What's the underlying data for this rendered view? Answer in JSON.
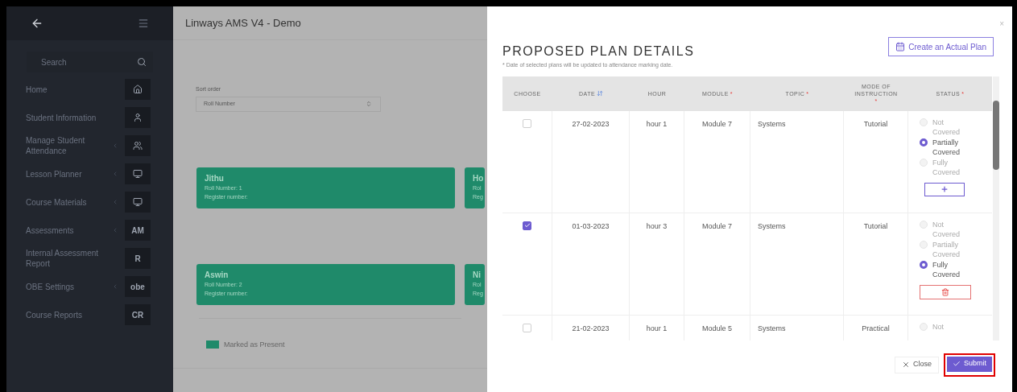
{
  "sidebar": {
    "search": {
      "placeholder": "Search"
    },
    "items": [
      {
        "label": "Home",
        "has_submenu": false
      },
      {
        "label": "Student Information",
        "has_submenu": false
      },
      {
        "label": "Manage Student Attendance",
        "has_submenu": true
      },
      {
        "label": "Lesson Planner",
        "has_submenu": true
      },
      {
        "label": "Course Materials",
        "has_submenu": true
      },
      {
        "label": "Assessments",
        "badge": "AM",
        "has_submenu": true
      },
      {
        "label": "Internal Assessment Report",
        "badge": "R",
        "has_submenu": false
      },
      {
        "label": "OBE Settings",
        "badge": "obe",
        "has_submenu": true
      },
      {
        "label": "Course Reports",
        "badge": "CR",
        "has_submenu": false
      }
    ]
  },
  "main": {
    "title": "Linways AMS V4 - Demo",
    "sort": {
      "label": "Sort order",
      "value": "Roll Number"
    },
    "card_rows": [
      [
        {
          "name": "Jithu",
          "lines": [
            "Roll Number: 1",
            "Register number:"
          ]
        },
        {
          "name": "Ho",
          "lines": [
            "Rol",
            "Reg"
          ]
        }
      ],
      [
        {
          "name": "Aswin",
          "lines": [
            "Roll Number: 2",
            "Register number:"
          ]
        },
        {
          "name": "Ni",
          "lines": [
            "Rol",
            "Reg"
          ]
        }
      ]
    ],
    "legend": {
      "label": "Marked as Present",
      "color": "#1f8a6a"
    }
  },
  "modal": {
    "close": "×",
    "title": "PROPOSED PLAN DETAILS",
    "note": "* Date of selected plans will be updated to attendance marking date.",
    "create_button": "Create an Actual Plan",
    "table": {
      "columns": [
        {
          "label": "CHOOSE",
          "sortable": false
        },
        {
          "label": "DATE",
          "sortable": true
        },
        {
          "label": "HOUR",
          "sortable": false
        },
        {
          "label": "MODULE",
          "required_mark": "*",
          "sortable": false
        },
        {
          "label": "TOPIC",
          "required_mark": "*",
          "sortable": false
        },
        {
          "label": "MODE OF INSTRUCTION",
          "required_mark": "*",
          "sortable": false
        },
        {
          "label": "STATUS",
          "required_mark": "*",
          "sortable": false
        }
      ],
      "rows": [
        {
          "checked": false,
          "date": "27-02-2023",
          "hour": "hour 1",
          "module": "Module 7",
          "topic": "Systems",
          "mode": "Tutorial",
          "status": [
            {
              "label": "Not Covered",
              "selected": false
            },
            {
              "label": "Partially Covered",
              "selected": true
            },
            {
              "label": "Fully Covered",
              "selected": false
            }
          ],
          "kind": "add"
        },
        {
          "checked": true,
          "date": "01-03-2023",
          "hour": "hour 3",
          "module": "Module 7",
          "topic": "Systems",
          "mode": "Tutorial",
          "status": [
            {
              "label": "Not Covered",
              "selected": false
            },
            {
              "label": "Partially Covered",
              "selected": false
            },
            {
              "label": "Fully Covered",
              "selected": true
            }
          ],
          "kind": "delete"
        },
        {
          "checked": false,
          "date": "21-02-2023",
          "hour": "hour 1",
          "module": "Module 5",
          "topic": "Systems",
          "mode": "Practical",
          "status": [
            {
              "label": "Not",
              "selected": false
            }
          ]
        }
      ]
    },
    "buttons": [
      {
        "kind": "close",
        "label": "Close",
        "highlighted": false
      },
      {
        "kind": "submit",
        "label": "Submit",
        "highlighted": true
      }
    ]
  }
}
